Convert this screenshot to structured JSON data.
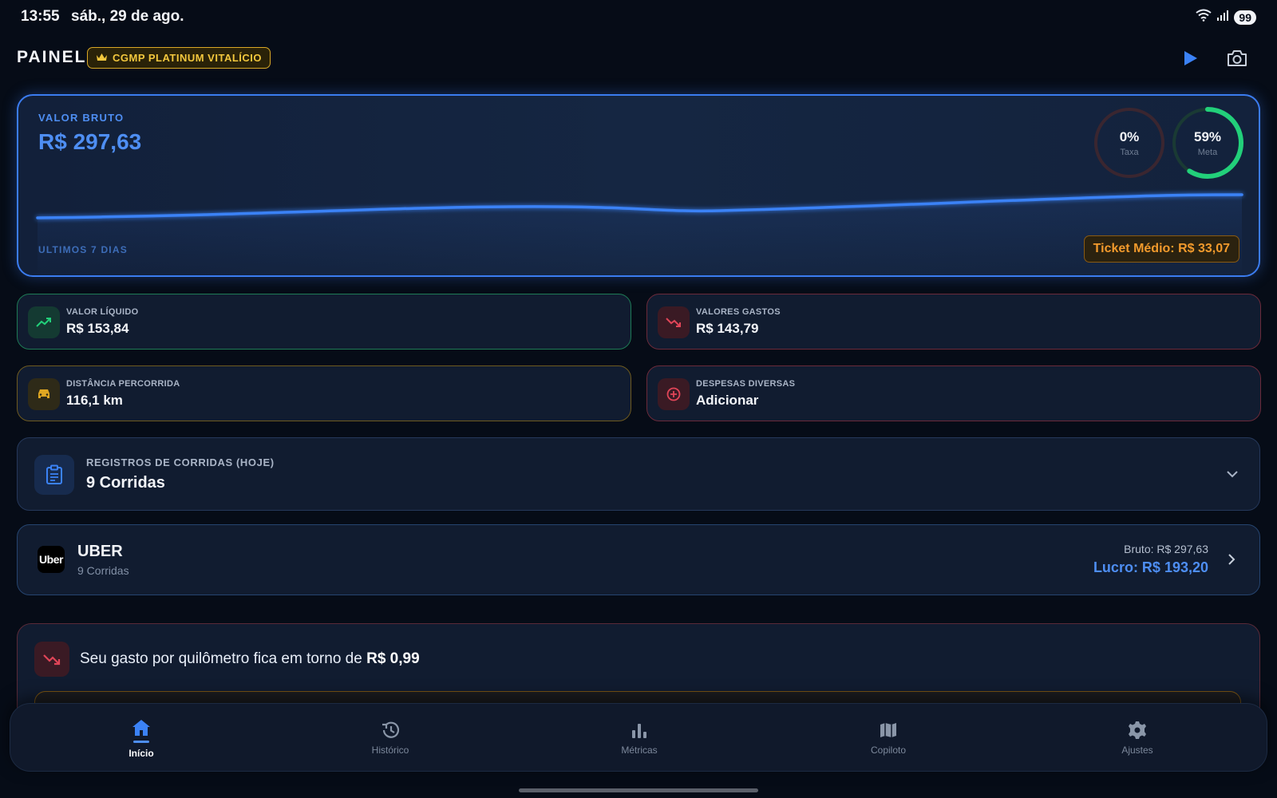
{
  "status": {
    "time": "13:55",
    "date": "sáb., 29 de ago.",
    "battery": "99"
  },
  "header": {
    "title": "PAINEL",
    "badge": "CGMP PLATINUM VITALÍCIO"
  },
  "main_card": {
    "label": "VALOR BRUTO",
    "value": "R$ 297,63",
    "footer": "ULTIMOS 7 DIAS",
    "ticket": "Ticket Médio: R$ 33,07",
    "taxa": {
      "pct": "0%",
      "label": "Taxa",
      "fraction": 0
    },
    "meta": {
      "pct": "59%",
      "label": "Meta",
      "fraction": 0.59
    }
  },
  "stats": {
    "liquido": {
      "label": "VALOR LÍQUIDO",
      "value": "R$ 153,84"
    },
    "gastos": {
      "label": "VALORES GASTOS",
      "value": "R$ 143,79"
    },
    "distancia": {
      "label": "DISTÂNCIA PERCORRIDA",
      "value": "116,1 km"
    },
    "despesas": {
      "label": "DESPESAS DIVERSAS",
      "value": "Adicionar"
    }
  },
  "registros": {
    "label": "REGISTROS DE CORRIDAS (HOJE)",
    "value": "9 Corridas"
  },
  "uber": {
    "logo": "Uber",
    "name": "UBER",
    "sub": "9 Corridas",
    "bruto": "Bruto: R$ 297,63",
    "lucro": "Lucro: R$ 193,20"
  },
  "insight": {
    "text": "Seu gasto por quilômetro fica em torno de ",
    "value": "R$ 0,99"
  },
  "nav": [
    {
      "label": "Início",
      "icon": "home-icon"
    },
    {
      "label": "Histórico",
      "icon": "history-icon"
    },
    {
      "label": "Métricas",
      "icon": "bar-chart-icon"
    },
    {
      "label": "Copiloto",
      "icon": "map-icon"
    },
    {
      "label": "Ajustes",
      "icon": "gear-icon"
    }
  ],
  "colors": {
    "accent": "#3b7cf0",
    "green": "#22d07a",
    "red": "#e04558",
    "amber": "#e0a722"
  }
}
